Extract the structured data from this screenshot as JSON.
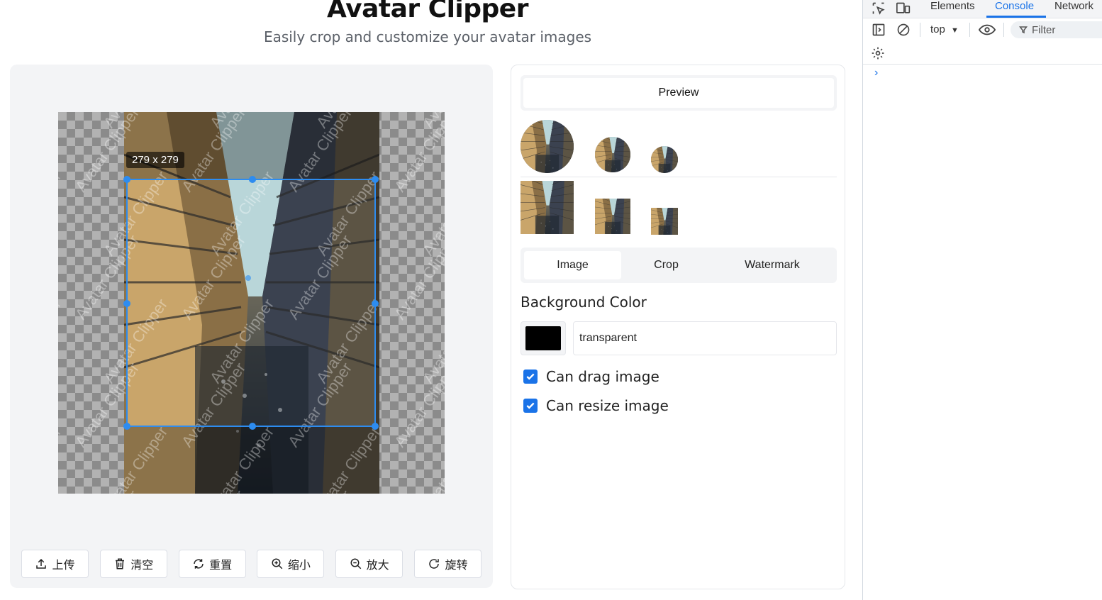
{
  "header": {
    "title": "Avatar Clipper",
    "subtitle": "Easily crop and customize your avatar images"
  },
  "editor": {
    "crop_size_label": "279 x 279",
    "watermark_text": "Avatar Clipper"
  },
  "toolbar": {
    "upload": "上传",
    "clear": "清空",
    "reset": "重置",
    "zoom_out": "缩小",
    "zoom_in": "放大",
    "rotate": "旋转"
  },
  "preview": {
    "heading": "Preview"
  },
  "tabs": [
    {
      "label": "Image",
      "active": true
    },
    {
      "label": "Crop",
      "active": false
    },
    {
      "label": "Watermark",
      "active": false
    }
  ],
  "settings": {
    "bg_color_label": "Background Color",
    "bg_color_swatch": "#000000",
    "bg_color_value": "transparent",
    "can_drag_label": "Can drag image",
    "can_drag_checked": true,
    "can_resize_label": "Can resize image",
    "can_resize_checked": true
  },
  "devtools": {
    "tabs": [
      "Elements",
      "Console",
      "Network"
    ],
    "active_tab": "Console",
    "context": "top",
    "filter_placeholder": "Filter",
    "accent": "#1a73e8"
  }
}
